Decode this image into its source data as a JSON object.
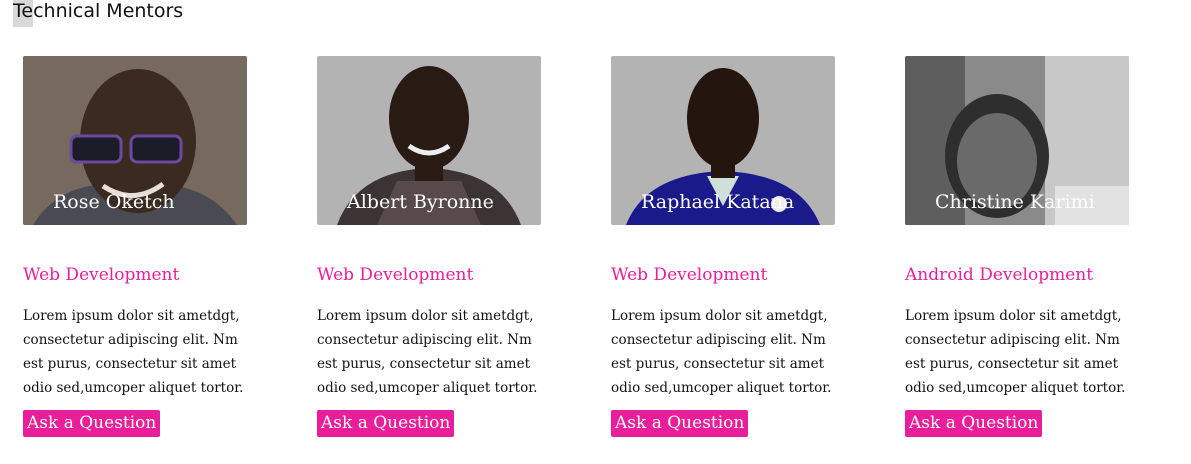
{
  "section": {
    "title_hl": "Te",
    "title_rest": "chnical Mentors"
  },
  "mentors": [
    {
      "name": "Rose Oketch",
      "area": "Web Development",
      "description": "Lorem ipsum dolor sit ametdgt, consectetur adipiscing elit. Nm est purus, consectetur sit amet odio sed,umcoper aliquet tortor.",
      "button": "Ask a Question",
      "photo_icon": "portrait-photo"
    },
    {
      "name": "Albert Byronne",
      "area": "Web Development",
      "description": "Lorem ipsum dolor sit ametdgt, consectetur adipiscing elit. Nm est purus, consectetur sit amet odio sed,umcoper aliquet tortor.",
      "button": "Ask a Question",
      "photo_icon": "portrait-photo"
    },
    {
      "name": "Raphael Katana",
      "area": "Web Development",
      "description": "Lorem ipsum dolor sit ametdgt, consectetur adipiscing elit. Nm est purus, consectetur sit amet odio sed,umcoper aliquet tortor.",
      "button": "Ask a Question",
      "photo_icon": "portrait-photo"
    },
    {
      "name": "Christine Karimi",
      "area": "Android Development",
      "description": "Lorem ipsum dolor sit ametdgt, consectetur adipiscing elit. Nm est purus, consectetur sit amet odio sed,umcoper aliquet tortor.",
      "button": "Ask a Question",
      "photo_icon": "portrait-photo"
    }
  ],
  "colors": {
    "accent": "#e91e9b",
    "text": "#111111",
    "photo_bg": "#b3b3b3"
  }
}
